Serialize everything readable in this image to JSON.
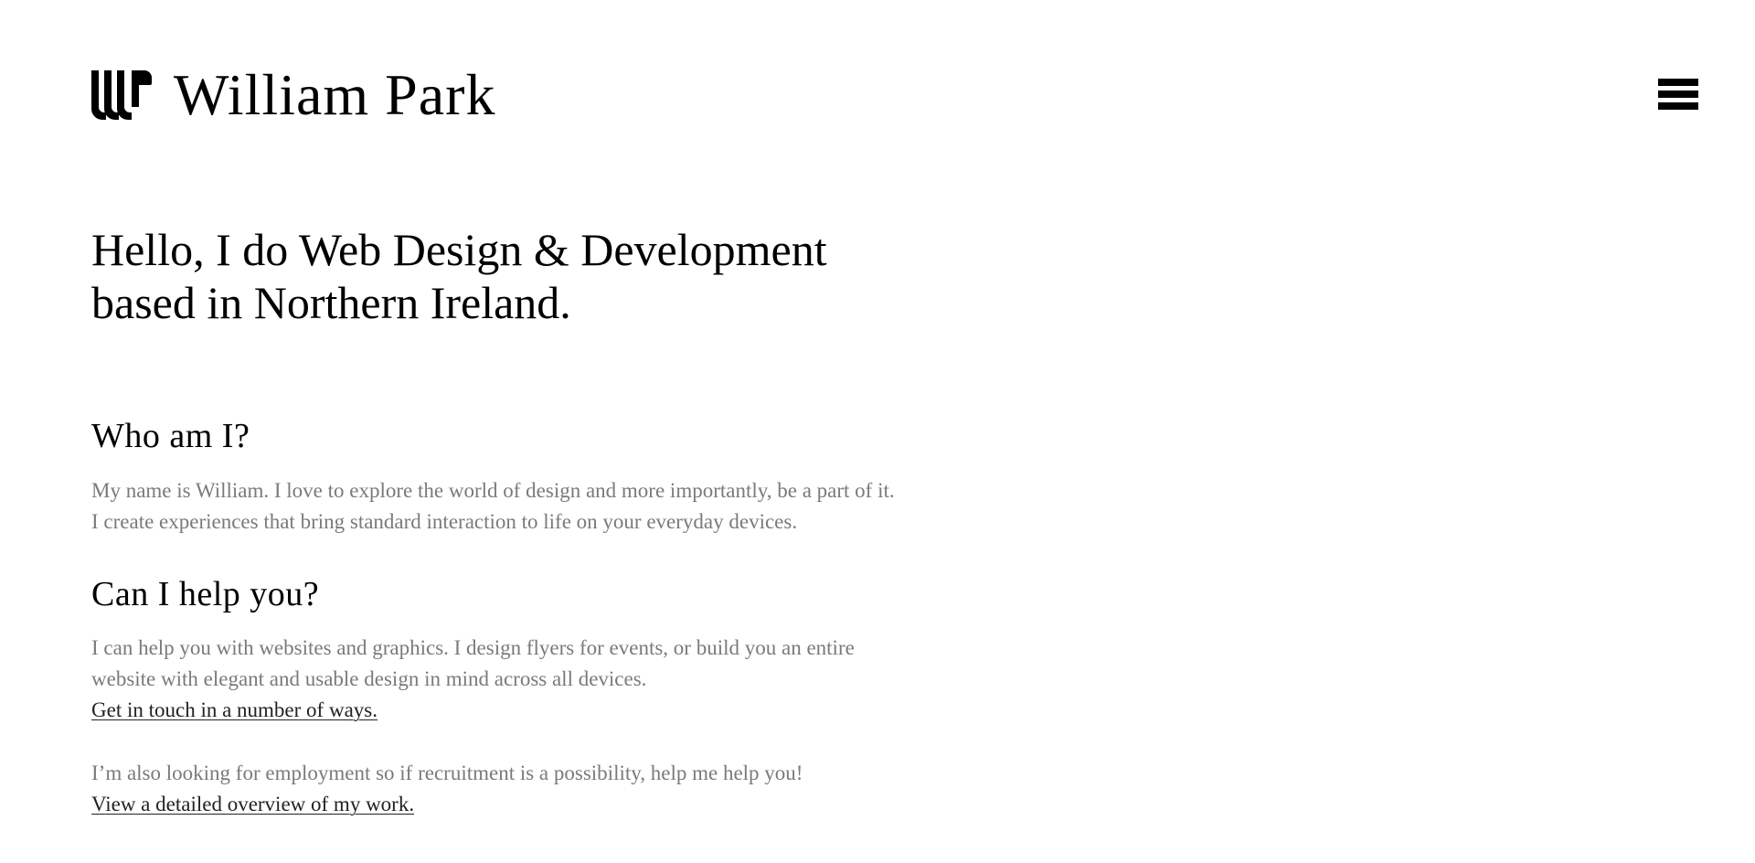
{
  "header": {
    "logo_icon": "wp-monogram-logo-icon",
    "title": "William Park",
    "menu_icon": "hamburger-menu-icon"
  },
  "intro": {
    "line1": "Hello, I do Web Design & Development",
    "line2": "based in Northern Ireland."
  },
  "who": {
    "heading": "Who am I?",
    "line1": "My name is William. I love to explore the world of design and more importantly, be a part of it.",
    "line2": "I create experiences that bring standard interaction to life on your everyday devices."
  },
  "help": {
    "heading": "Can I help you?",
    "line1": "I can help you with websites and graphics. I design flyers for events, or build you an entire",
    "line2": "website with elegant and usable design in mind across all devices.",
    "link": "Get in touch in a number of ways.",
    "employment": "I’m also looking for employment so if recruitment is a possibility, help me help you!",
    "work_link": "View a detailed overview of my work."
  },
  "colors": {
    "text": "#000000",
    "muted": "#7a7a7a",
    "background": "#ffffff"
  }
}
